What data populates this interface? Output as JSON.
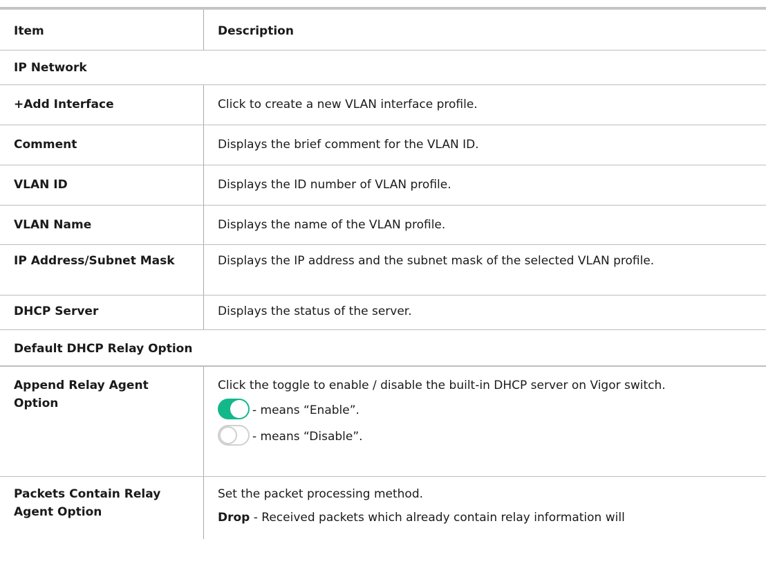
{
  "header": {
    "item": "Item",
    "description": "Description"
  },
  "sections": {
    "ip_network": "IP Network",
    "dhcp_relay": "Default DHCP Relay Option"
  },
  "rows": [
    {
      "item": "+Add Interface",
      "description": "Click to create a new VLAN interface profile."
    },
    {
      "item": "Comment",
      "description": "Displays the brief comment for the VLAN ID."
    },
    {
      "item": "VLAN ID",
      "description": "Displays the ID number of VLAN profile."
    },
    {
      "item": "VLAN Name",
      "description": "Displays the name of the VLAN profile."
    },
    {
      "item": "IP Address/Subnet Mask",
      "description": "Displays the IP address and the subnet mask of the selected VLAN profile."
    },
    {
      "item": "DHCP Server",
      "description": "Displays the status of the server."
    }
  ],
  "append_relay": {
    "item": "Append Relay Agent Option",
    "description": "Click the toggle to enable / disable the built-in DHCP server on Vigor switch.",
    "enable_text": " - means “Enable”.",
    "disable_text": " - means “Disable”.",
    "toggle_on_color": "#13b88a",
    "toggle_off_color": "#d0d0d0"
  },
  "packets_contain": {
    "item": "Packets Contain Relay Agent Option",
    "description": "Set the packet processing method.",
    "drop_label": "Drop",
    "drop_text": " - Received packets which already contain relay information will"
  }
}
